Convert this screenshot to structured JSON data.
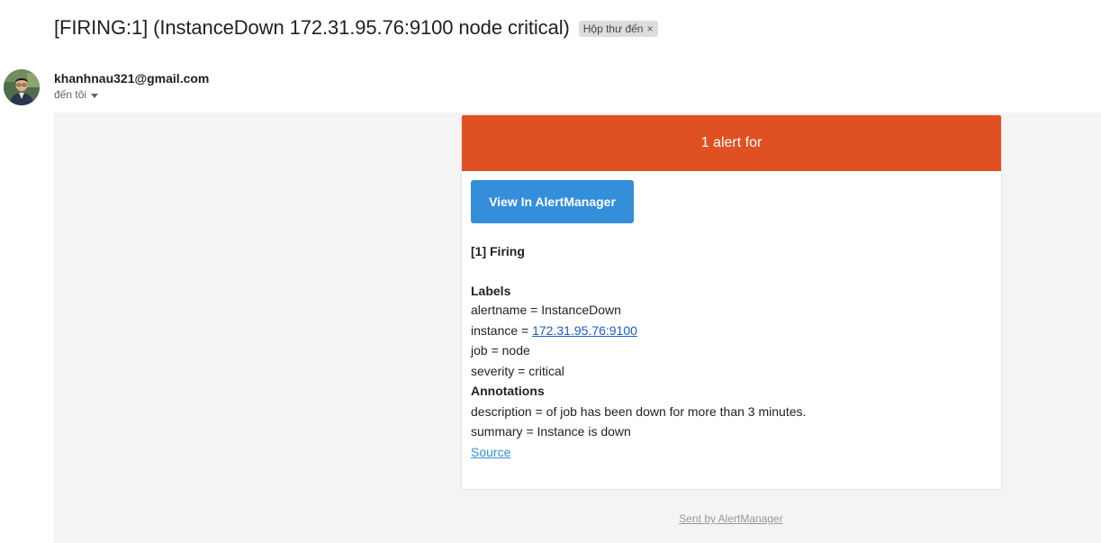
{
  "email": {
    "subject": "[FIRING:1] (InstanceDown 172.31.95.76:9100 node critical)",
    "label_chip": "Hộp thư đến",
    "label_close": "×",
    "sender": "khanhnau321@gmail.com",
    "to_line": "đến tôi"
  },
  "alert": {
    "header": "1 alert for",
    "header_color": "#df5122",
    "button_label": "View In AlertManager",
    "button_color": "#348eda",
    "firing_title": "[1] Firing",
    "labels_title": "Labels",
    "labels": {
      "alertname": "alertname = InstanceDown",
      "instance_prefix": "instance = ",
      "instance_link": "172.31.95.76:9100",
      "job": "job = node",
      "severity": "severity = critical"
    },
    "annotations_title": "Annotations",
    "annotations": {
      "description": "description = of job has been down for more than 3 minutes.",
      "summary": "summary = Instance is down"
    },
    "source_link": "Source"
  },
  "footer": {
    "sent_by": "Sent by AlertManager"
  }
}
